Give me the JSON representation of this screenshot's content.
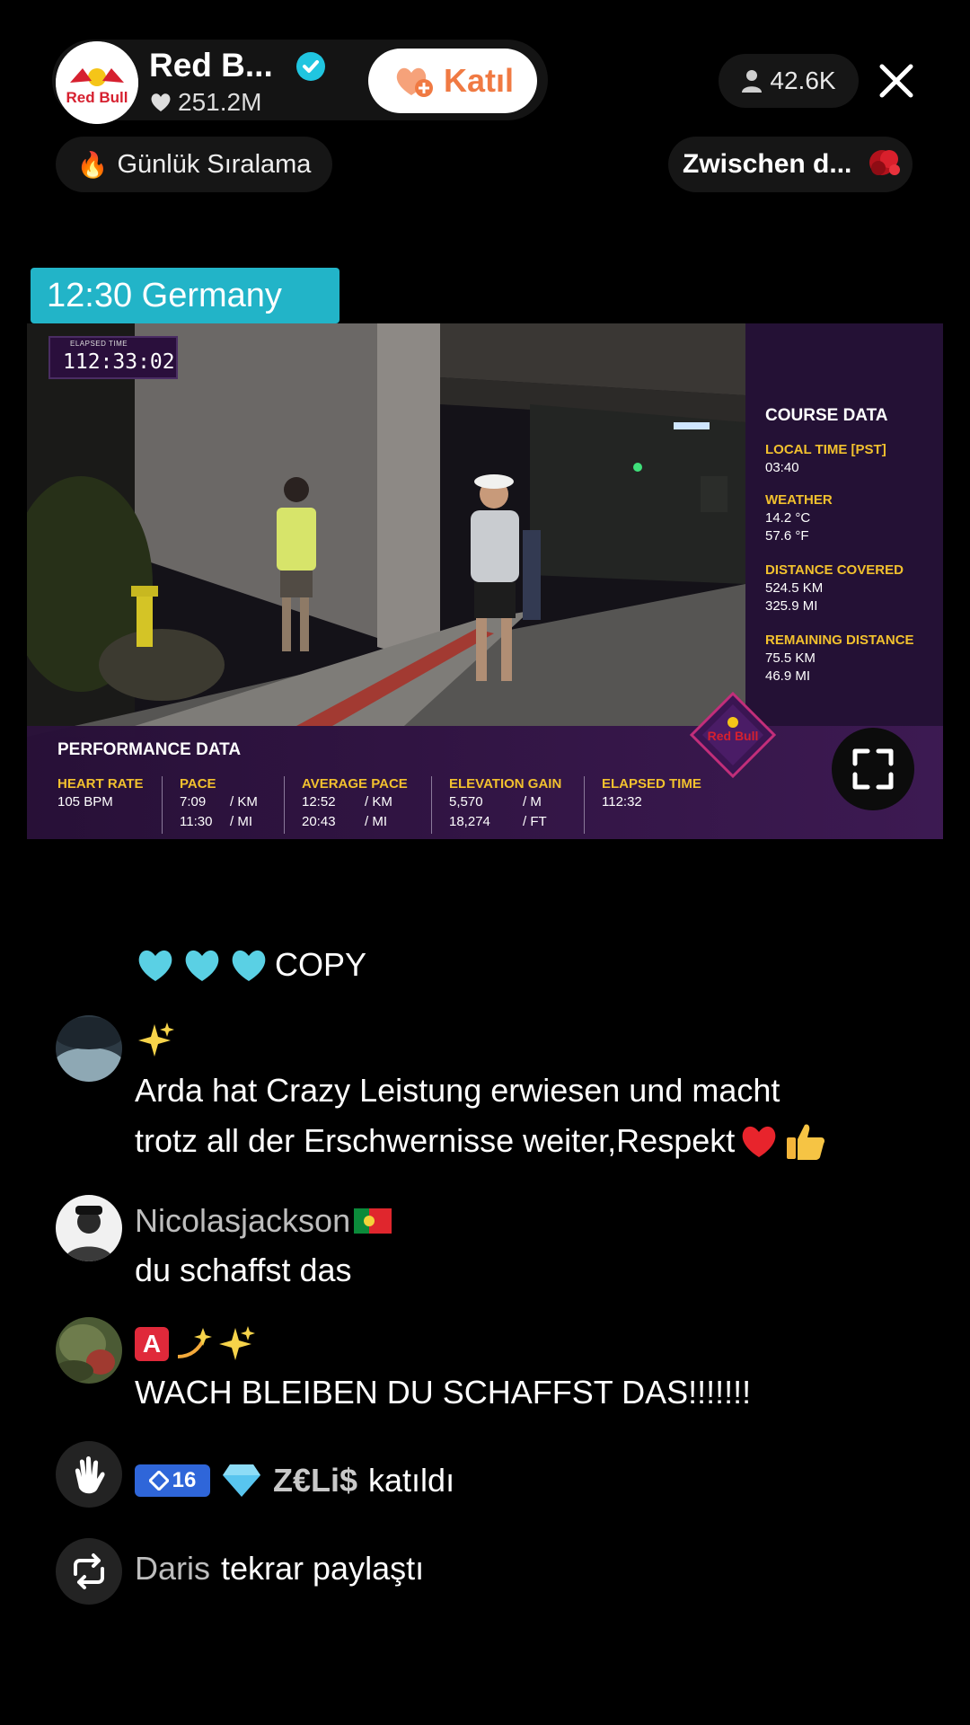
{
  "header": {
    "host_name": "Red B...",
    "likes": "251.2M",
    "join_label": "Katıl",
    "viewers": "42.6K",
    "ranking_label": "Günlük Sıralama",
    "gift_label": "Zwischen d...",
    "time_badge": "12:30 Germany"
  },
  "stream": {
    "elapsed_small": "ELAPSED TIME",
    "elapsed_big": "112:33:02",
    "course": {
      "title": "COURSE DATA",
      "local_time_label": "LOCAL TIME [PST]",
      "local_time": "03:40",
      "weather_label": "WEATHER",
      "weather_c": "14.2 °C",
      "weather_f": "57.6 °F",
      "distance_label": "DISTANCE COVERED",
      "distance_km": "524.5 KM",
      "distance_mi": "325.9 MI",
      "remaining_label": "REMAINING DISTANCE",
      "remaining_km": "75.5 KM",
      "remaining_mi": "46.9 MI"
    },
    "performance": {
      "title": "PERFORMANCE DATA",
      "heart_rate_label": "HEART RATE",
      "heart_rate": "105 BPM",
      "pace_label": "PACE",
      "pace_km": "7:09",
      "pace_mi": "11:30",
      "avg_pace_label": "AVERAGE PACE",
      "avg_pace_km": "12:52",
      "avg_pace_mi": "20:43",
      "elevation_label": "ELEVATION GAIN",
      "elevation_m": "5,570",
      "elevation_ft": "18,274",
      "elapsed_label": "ELAPSED TIME",
      "elapsed": "112:32",
      "unit_km": "/  KM",
      "unit_mi": "/  MI",
      "unit_m": "/    M",
      "unit_ft": "/    FT"
    },
    "badge_text": "Red Bull"
  },
  "chat": {
    "copy_text": "COPY",
    "msg1_line1": "Arda hat Crazy Leistung erwiesen und macht",
    "msg1_line2": "trotz all der Erschwernisse weiter,Respekt",
    "user2": "Nicolasjackson",
    "msg2": "du schaffst das",
    "tag3": "A",
    "msg3": "WACH BLEIBEN DU SCHAFFST DAS!!!!!!!",
    "level": "16",
    "user4": "Z€Li$",
    "joined": "katıldı",
    "user5": "Daris",
    "shared": "tekrar paylaştı"
  },
  "colors": {
    "accent_orange": "#f07a43",
    "time_badge_bg": "#22b4c8",
    "overlay_yellow": "#f2c12e",
    "overlay_purple": "#2a0f3c"
  }
}
